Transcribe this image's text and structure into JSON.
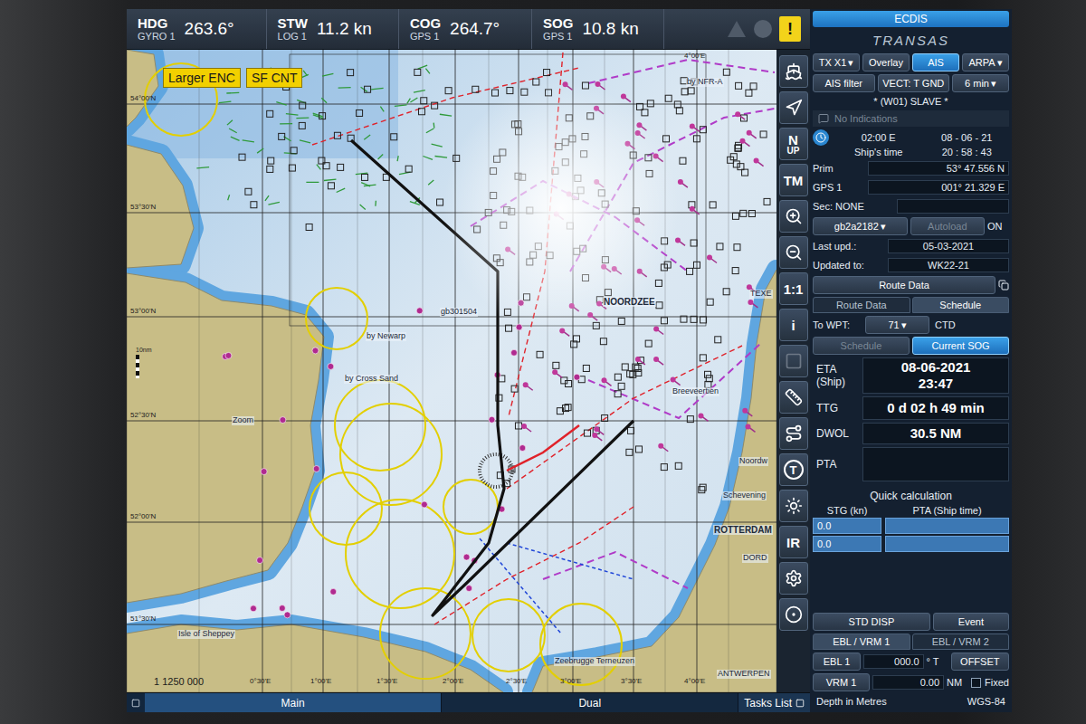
{
  "top_bar": {
    "readouts": [
      {
        "label": "HDG",
        "source": "GYRO 1",
        "value": "263.6°"
      },
      {
        "label": "STW",
        "source": "LOG 1",
        "value": "11.2 kn"
      },
      {
        "label": "COG",
        "source": "GPS 1",
        "value": "264.7°"
      },
      {
        "label": "SOG",
        "source": "GPS 1",
        "value": "10.8 kn"
      }
    ],
    "alarm": "!"
  },
  "chart_badges": [
    "Larger ENC",
    "SF CNT"
  ],
  "map": {
    "scale": "1  1250 000",
    "scale_bar": "10nm",
    "lat_ticks": [
      "54°00'N",
      "53°30'N",
      "53°00'N",
      "52°30'N",
      "52°00'N",
      "51°30'N"
    ],
    "lon_ticks": [
      "0°30'E",
      "1°00'E",
      "1°30'E",
      "2°00'E",
      "2°30'E",
      "3°00'E",
      "3°30'E",
      "4°00'E"
    ],
    "top_lon_tick": "4°00'E",
    "labels": [
      "NOORDZEE",
      "Schevening",
      "ROTTERDAM",
      "DORD",
      "ANTWERPEN",
      "Isle of Sheppey",
      "Zeebrugge Terneuzen",
      "Noordw",
      "TEXE",
      "Zoom",
      "by Cross Sand",
      "by Newarp",
      "Breeveertien",
      "by NFR-A",
      "gb301504"
    ]
  },
  "toolbar": [
    {
      "kind": "icon",
      "disabled": false
    },
    {
      "kind": "icon",
      "disabled": false
    },
    {
      "kind": "text",
      "text": "N",
      "subtext": "UP",
      "disabled": false
    },
    {
      "kind": "text",
      "text": "TM",
      "disabled": false
    },
    {
      "kind": "icon",
      "disabled": false
    },
    {
      "kind": "icon",
      "disabled": false
    },
    {
      "kind": "text",
      "text": "1:1",
      "disabled": false
    },
    {
      "kind": "text",
      "text": "i",
      "disabled": false
    },
    {
      "kind": "icon",
      "disabled": true
    },
    {
      "kind": "icon",
      "disabled": false
    },
    {
      "kind": "icon",
      "disabled": false
    },
    {
      "kind": "badge",
      "text": "T",
      "disabled": false
    },
    {
      "kind": "icon",
      "disabled": false
    },
    {
      "kind": "text",
      "text": "IR",
      "disabled": false
    },
    {
      "kind": "icon",
      "disabled": false
    },
    {
      "kind": "icon",
      "disabled": false
    }
  ],
  "panel": {
    "title": "ECDIS",
    "logo": "TRANSAS",
    "dropdown_glyph": "▾",
    "mode_buttons": [
      {
        "label": "TX X1",
        "dropdown": true,
        "selected": false
      },
      {
        "label": "Overlay",
        "dropdown": false,
        "selected": false
      },
      {
        "label": "AIS",
        "dropdown": false,
        "selected": true
      },
      {
        "label": "ARPA",
        "dropdown": true,
        "selected": false
      }
    ],
    "ais_row": {
      "filter": "AIS filter",
      "vector": "VECT: T GND",
      "vector_time": "6 min"
    },
    "station": "* (W01) SLAVE *",
    "indications": {
      "text": "No Indications",
      "disabled": true
    },
    "time": {
      "zone": "02:00 E",
      "date": "08 - 06 - 21",
      "label": "Ship's time",
      "time": "20 : 58 : 43"
    },
    "position": {
      "prim_label": "Prim",
      "lat": "53° 47.556 N",
      "source": "GPS 1",
      "lon": "001° 21.329 E",
      "sec": "Sec: NONE"
    },
    "chart": {
      "cell": "gb2a2182",
      "autoload": {
        "label": "Autoload",
        "disabled": true
      },
      "state": "ON",
      "last_upd_label": "Last upd.:",
      "last_upd": "05-03-2021",
      "updated_to_label": "Updated to:",
      "updated_to": "WK22-21"
    },
    "section": "Route Data",
    "section_tabs": [
      {
        "label": "Route Data",
        "selected": false
      },
      {
        "label": "Schedule",
        "selected": true
      }
    ],
    "to_wpt": {
      "label": "To WPT:",
      "value": "71",
      "ctd": "CTD"
    },
    "speed_modes": [
      {
        "label": "Schedule",
        "selected": false,
        "disabled": true
      },
      {
        "label": "Current SOG",
        "selected": true,
        "disabled": false
      }
    ],
    "eta": {
      "label": "ETA",
      "sub": "(Ship)",
      "date": "08-06-2021",
      "time": "23:47"
    },
    "ttg": {
      "label": "TTG",
      "value": "0 d 02 h 49 min"
    },
    "dwol": {
      "label": "DWOL",
      "value": "30.5 NM"
    },
    "pta": {
      "label": "PTA",
      "value": ""
    },
    "quick": {
      "title": "Quick calculation",
      "columns": [
        "STG (kn)",
        "PTA (Ship time)"
      ],
      "rows": [
        {
          "stg": "0.0",
          "pta": ""
        },
        {
          "stg": "0.0",
          "pta": ""
        }
      ]
    },
    "actions": [
      "STD DISP",
      "Event"
    ],
    "ebl_tabs": [
      {
        "label": "EBL / VRM 1",
        "selected": true
      },
      {
        "label": "EBL / VRM 2",
        "selected": false
      }
    ],
    "ebl": {
      "label": "EBL 1",
      "value": "000.0",
      "unit": "° T",
      "offset": "OFFSET"
    },
    "vrm": {
      "label": "VRM 1",
      "value": "0.00",
      "unit": "NM",
      "fixed": {
        "label": "Fixed",
        "checked": false
      }
    },
    "footer": {
      "depth": "Depth in Metres",
      "datum": "WGS-84"
    }
  },
  "bottom_bar": {
    "tabs": [
      {
        "label": "Main",
        "selected": true
      },
      {
        "label": "Dual",
        "selected": false
      }
    ],
    "tasks": "Tasks List"
  }
}
